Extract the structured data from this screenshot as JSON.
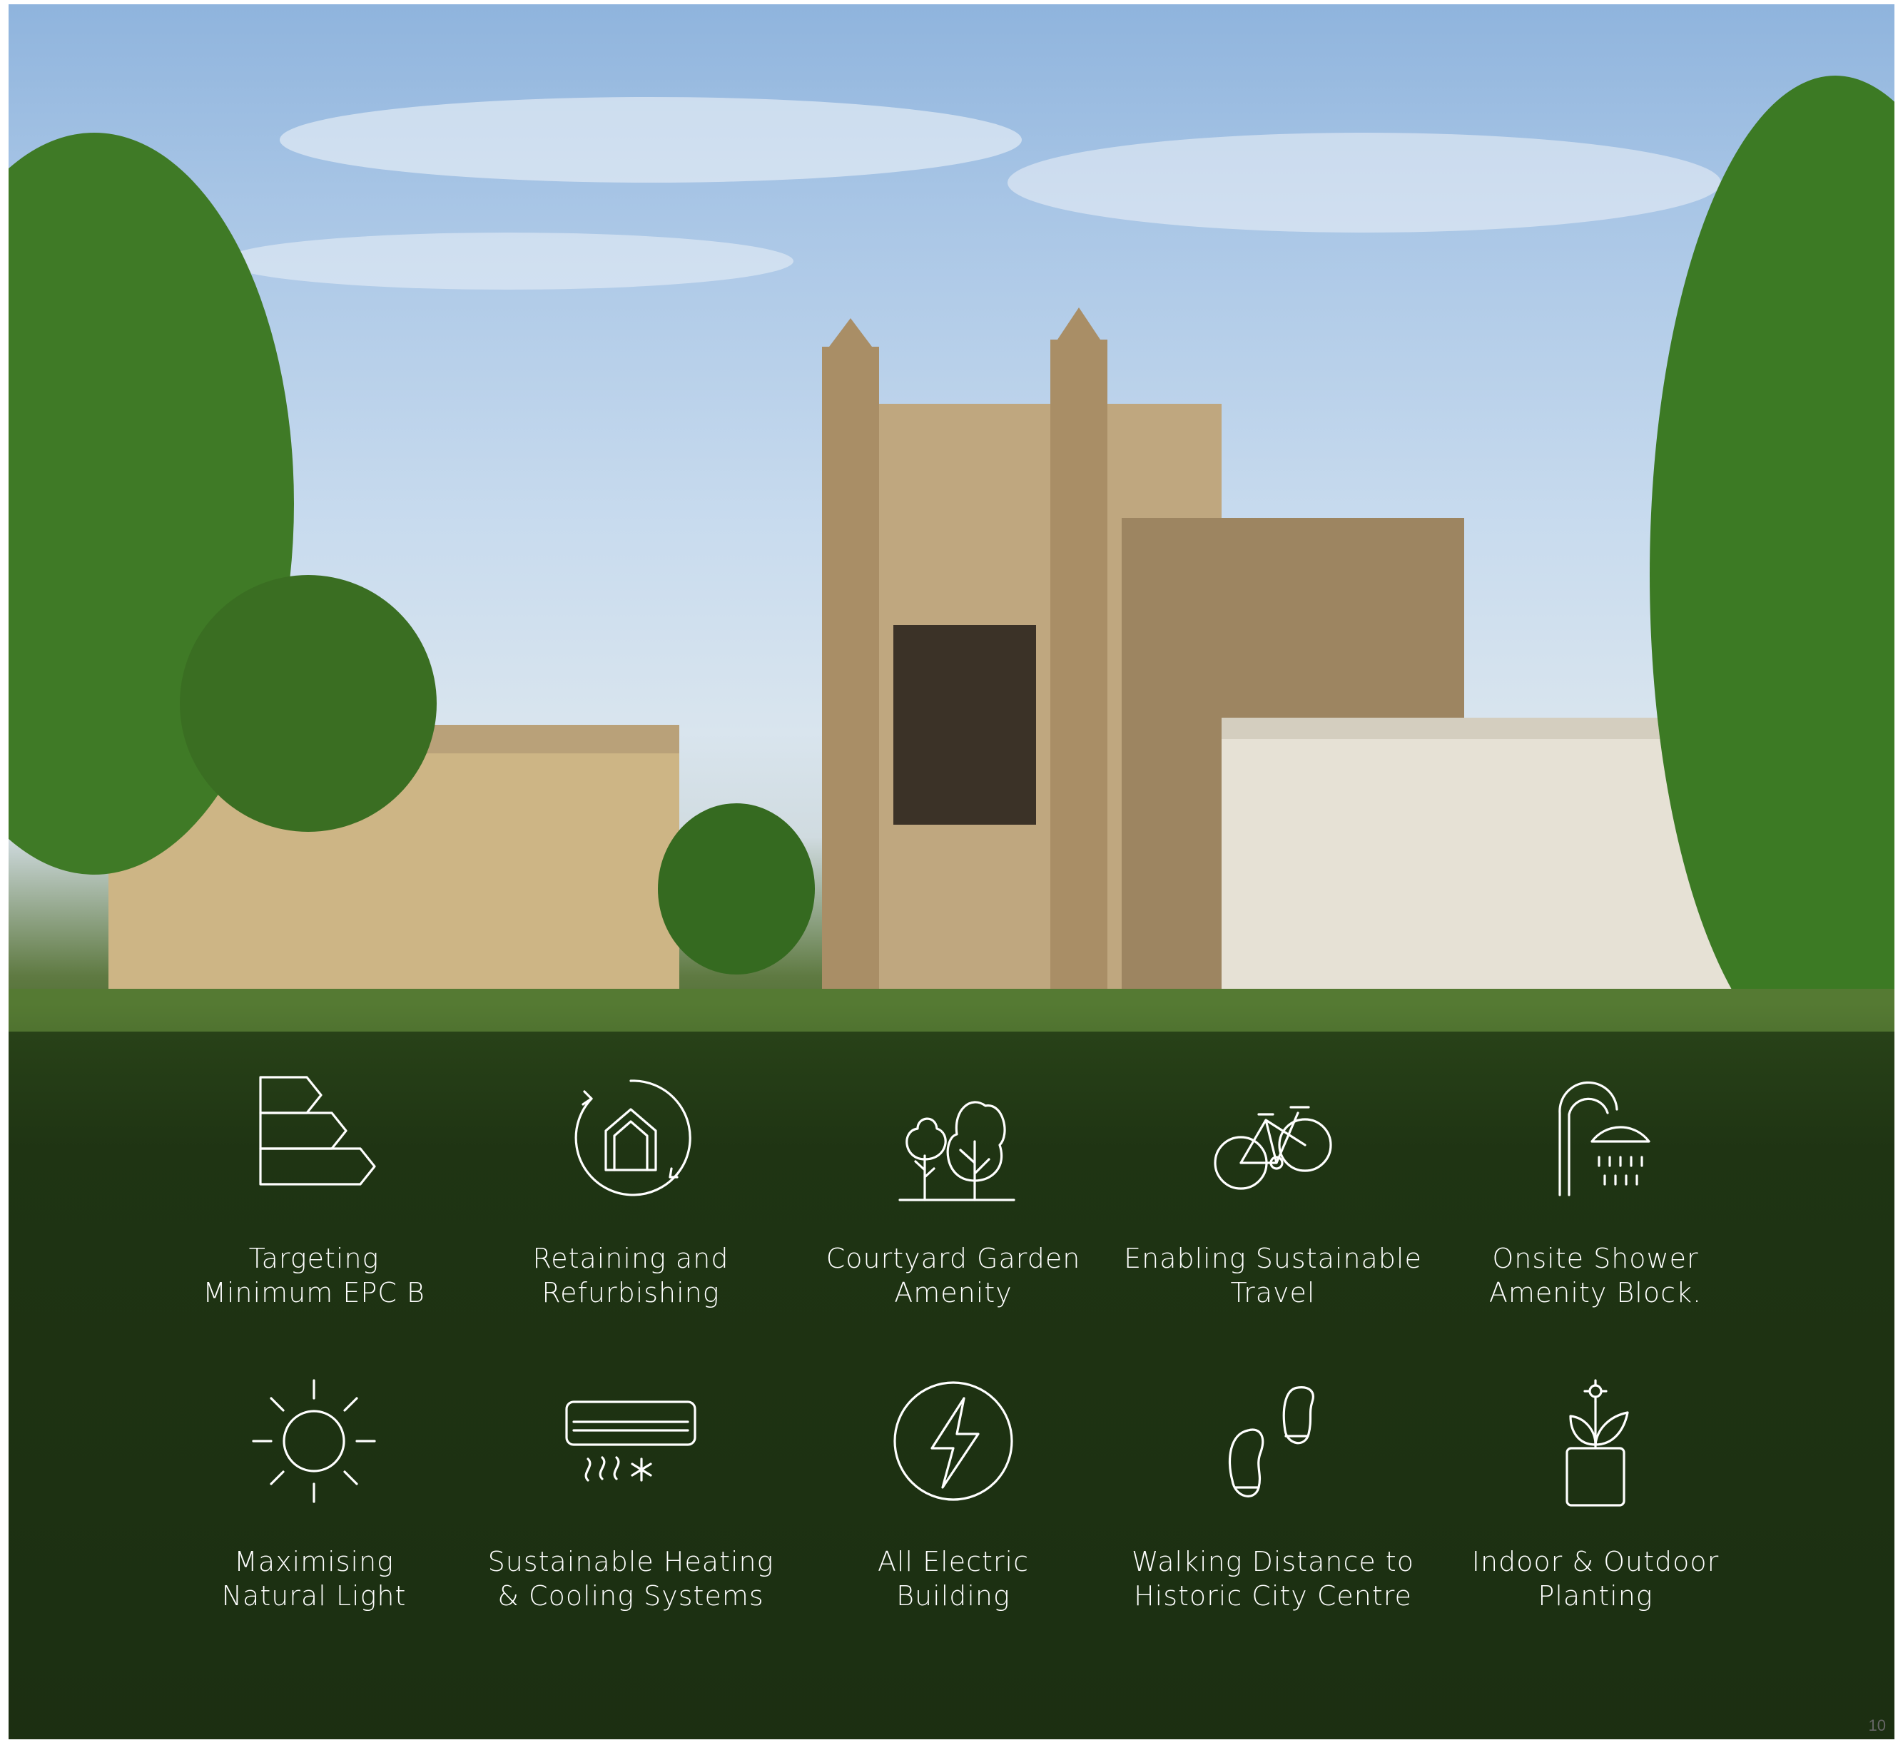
{
  "features": [
    {
      "label_line1": "Targeting",
      "label_line2": "Minimum EPC B",
      "icon": "epc-rating-icon"
    },
    {
      "label_line1": "Retaining and",
      "label_line2": "Refurbishing",
      "icon": "refurbish-house-icon"
    },
    {
      "label_line1": "Courtyard Garden",
      "label_line2": "Amenity",
      "icon": "trees-icon"
    },
    {
      "label_line1": "Enabling Sustainable",
      "label_line2": "Travel",
      "icon": "bicycle-icon"
    },
    {
      "label_line1": "Onsite Shower",
      "label_line2": "Amenity Block.",
      "icon": "shower-icon"
    },
    {
      "label_line1": "Maximising",
      "label_line2": "Natural Light",
      "icon": "sun-icon"
    },
    {
      "label_line1": "Sustainable Heating",
      "label_line2": "& Cooling Systems",
      "icon": "air-conditioner-icon"
    },
    {
      "label_line1": "All Electric",
      "label_line2": "Building",
      "icon": "lightning-icon"
    },
    {
      "label_line1": "Walking Distance to",
      "label_line2": "Historic City Centre",
      "icon": "footprints-icon"
    },
    {
      "label_line1": "Indoor & Outdoor",
      "label_line2": "Planting",
      "icon": "potted-plant-icon"
    }
  ],
  "page_number": "10"
}
